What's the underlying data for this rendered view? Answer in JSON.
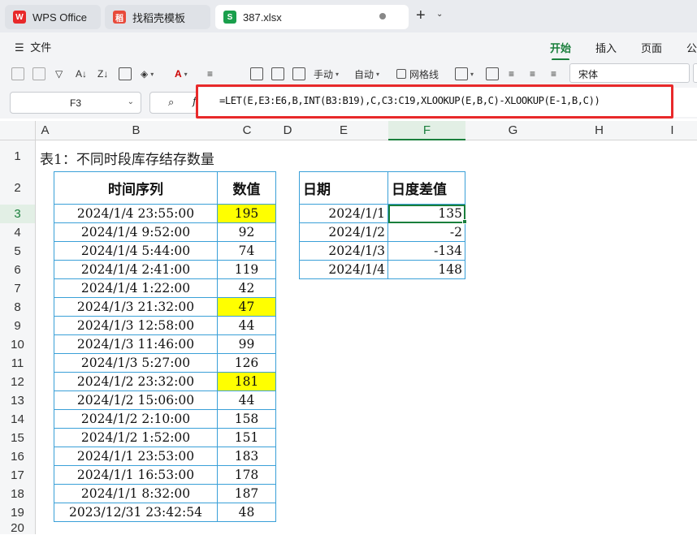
{
  "tabs": [
    {
      "label": "WPS Office",
      "icon": "wps-logo-icon",
      "color": "#e8292a"
    },
    {
      "label": "找稻壳模板",
      "icon": "docer-logo-icon",
      "color": "#e84a3a"
    },
    {
      "label": "387.xlsx",
      "icon": "spreadsheet-icon",
      "color": "#1a9f4c"
    }
  ],
  "menu": {
    "file_label": "文件"
  },
  "ribbon_tabs": [
    "开始",
    "插入",
    "页面",
    "公"
  ],
  "toolbar": {
    "manual_label": "手动",
    "auto_label": "自动",
    "gridlines_label": "网格线",
    "font_name": "宋体"
  },
  "name_box": "F3",
  "formula": "=LET(E,E3:E6,B,INT(B3:B19),C,C3:C19,XLOOKUP(E,B,C)-XLOOKUP(E-1,B,C))",
  "columns": [
    "A",
    "B",
    "C",
    "D",
    "E",
    "F",
    "G",
    "H",
    "I"
  ],
  "rows": [
    "1",
    "2",
    "3",
    "4",
    "5",
    "6",
    "7",
    "8",
    "9",
    "10",
    "11",
    "12",
    "13",
    "14",
    "15",
    "16",
    "17",
    "18",
    "19",
    "20"
  ],
  "sheet": {
    "title": "表1：不同时段库存结存数量",
    "table1": {
      "headers": [
        "时间序列",
        "数值"
      ],
      "rows": [
        [
          "2024/1/4 23:55:00",
          "195"
        ],
        [
          "2024/1/4 9:52:00",
          "92"
        ],
        [
          "2024/1/4 5:44:00",
          "74"
        ],
        [
          "2024/1/4 2:41:00",
          "119"
        ],
        [
          "2024/1/4 1:22:00",
          "42"
        ],
        [
          "2024/1/3 21:32:00",
          "47"
        ],
        [
          "2024/1/3 12:58:00",
          "44"
        ],
        [
          "2024/1/3 11:46:00",
          "99"
        ],
        [
          "2024/1/3 5:27:00",
          "126"
        ],
        [
          "2024/1/2 23:32:00",
          "181"
        ],
        [
          "2024/1/2 15:06:00",
          "44"
        ],
        [
          "2024/1/2 2:10:00",
          "158"
        ],
        [
          "2024/1/2 1:52:00",
          "151"
        ],
        [
          "2024/1/1 23:53:00",
          "183"
        ],
        [
          "2024/1/1 16:53:00",
          "178"
        ],
        [
          "2024/1/1 8:32:00",
          "187"
        ],
        [
          "2023/12/31 23:42:54",
          "48"
        ]
      ],
      "highlighted_rows": [
        0,
        5,
        9
      ],
      "highlight_color": "#ffff00"
    },
    "table2": {
      "headers": [
        "日期",
        "日度差值"
      ],
      "rows": [
        [
          "2024/1/1",
          "135"
        ],
        [
          "2024/1/2",
          "-2"
        ],
        [
          "2024/1/3",
          "-134"
        ],
        [
          "2024/1/4",
          "148"
        ]
      ]
    }
  },
  "colors": {
    "accent": "#1a7f3c",
    "border": "#3aa0d8",
    "formula_frame": "#e8292a"
  }
}
